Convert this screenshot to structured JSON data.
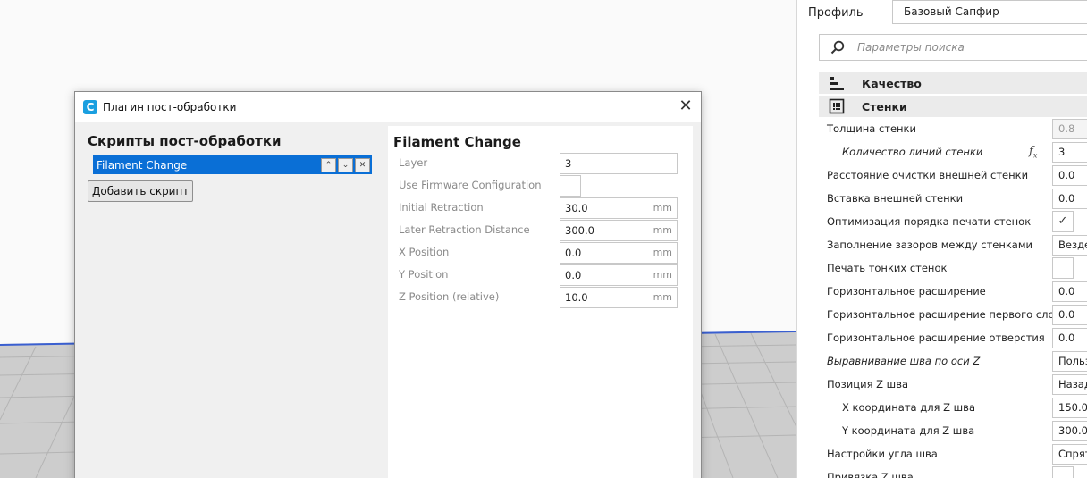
{
  "dialog": {
    "title": "Плагин пост-обработки",
    "close_glyph": "✕",
    "logo_glyph": "C",
    "scripts_heading": "Скрипты пост-обработки",
    "script_list": [
      {
        "label": "Filament Change",
        "selected": true
      }
    ],
    "list_buttons": {
      "up": "⌃",
      "down": "⌄",
      "remove": "✕"
    },
    "add_script_label": "Добавить скрипт",
    "script_settings": {
      "heading": "Filament Change",
      "fields": [
        {
          "label": "Layer",
          "value": "3",
          "unit": ""
        },
        {
          "label": "Use Firmware Configuration",
          "checked": false,
          "type": "checkbox"
        },
        {
          "label": "Initial Retraction",
          "value": "30.0",
          "unit": "mm"
        },
        {
          "label": "Later Retraction Distance",
          "value": "300.0",
          "unit": "mm"
        },
        {
          "label": "X Position",
          "value": "0.0",
          "unit": "mm"
        },
        {
          "label": "Y Position",
          "value": "0.0",
          "unit": "mm"
        },
        {
          "label": "Z Position (relative)",
          "value": "10.0",
          "unit": "mm"
        }
      ]
    }
  },
  "settings_panel": {
    "profile_label": "Профиль",
    "profile_value": "Базовый Сапфир",
    "search_placeholder": "Параметры поиска",
    "sections": [
      {
        "label": "Качество",
        "icon": "quality-icon"
      },
      {
        "label": "Стенки",
        "icon": "walls-icon"
      }
    ],
    "settings": [
      {
        "label": "Толщина стенки",
        "value": "0.8",
        "disabled": true
      },
      {
        "label": "Количество линий стенки",
        "value": "3",
        "italic": true,
        "indent": true,
        "function": "fx"
      },
      {
        "label": "Расстояние очистки внешней стенки",
        "value": "0.0"
      },
      {
        "label": "Вставка внешней стенки",
        "value": "0.0"
      },
      {
        "label": "Оптимизация порядка печати стенок",
        "checked": true,
        "type": "checkbox"
      },
      {
        "label": "Заполнение зазоров между стенками",
        "value": "Везде"
      },
      {
        "label": "Печать тонких стенок",
        "checked": false,
        "type": "checkbox"
      },
      {
        "label": "Горизонтальное расширение",
        "value": "0.0"
      },
      {
        "label": "Горизонтальное расширение первого слоя",
        "value": "0.0"
      },
      {
        "label": "Горизонтальное расширение отверстия",
        "value": "0.0"
      },
      {
        "label": "Выравнивание шва по оси Z",
        "value": "Пользовательский",
        "italic": true
      },
      {
        "label": "Позиция Z шва",
        "value": "Назад"
      },
      {
        "label": "X координата для Z шва",
        "value": "150.0",
        "indent": true
      },
      {
        "label": "Y координата для Z шва",
        "value": "300.0",
        "indent": true
      },
      {
        "label": "Настройки угла шва",
        "value": "Спрятать"
      },
      {
        "label": "Привязка Z шва",
        "checked": false,
        "type": "checkbox"
      }
    ],
    "check_glyph": "✓"
  },
  "colors": {
    "accent": "#0a6fd6",
    "logo": "#1a9fe0",
    "build_plate_edge": "#3a5fd0"
  }
}
